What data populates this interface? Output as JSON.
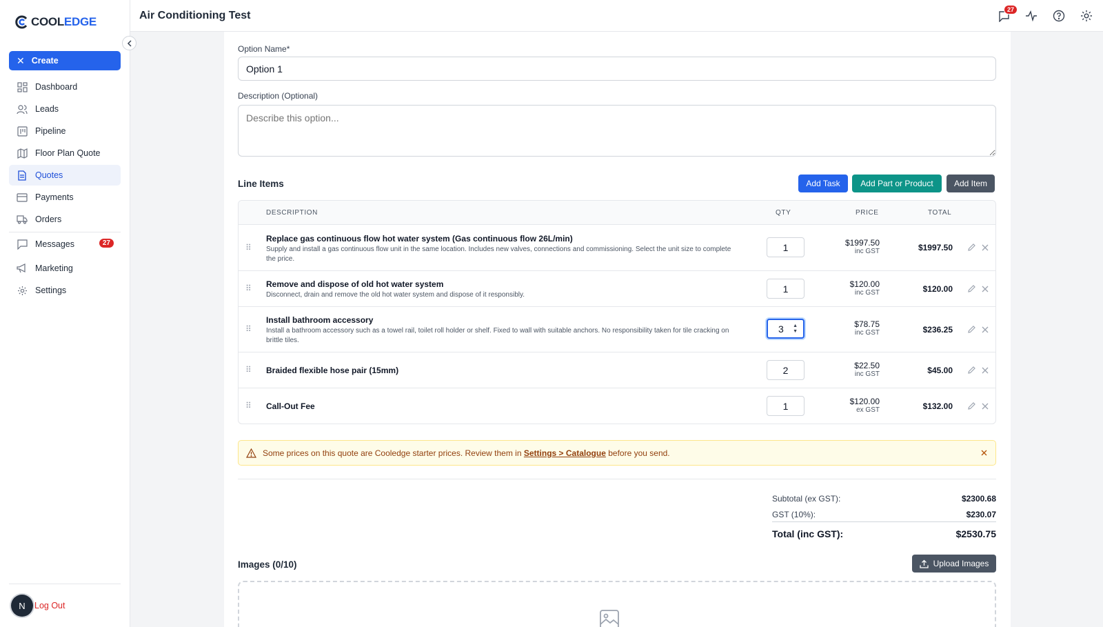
{
  "brand": {
    "name_part1": "COOL",
    "name_part2": "EDGE"
  },
  "sidebar": {
    "create_label": "Create",
    "items": [
      {
        "label": "Dashboard",
        "icon": "dashboard-icon"
      },
      {
        "label": "Leads",
        "icon": "users-icon"
      },
      {
        "label": "Pipeline",
        "icon": "pipeline-icon"
      },
      {
        "label": "Floor Plan Quote",
        "icon": "map-icon"
      },
      {
        "label": "Quotes",
        "icon": "document-icon",
        "active": true
      },
      {
        "label": "Payments",
        "icon": "credit-card-icon"
      },
      {
        "label": "Orders",
        "icon": "truck-icon"
      },
      {
        "label": "Messages",
        "icon": "message-icon",
        "badge": "27"
      },
      {
        "label": "Marketing",
        "icon": "megaphone-icon"
      },
      {
        "label": "Settings",
        "icon": "gear-icon"
      }
    ],
    "avatar_initial": "N",
    "logout_label": "Log Out"
  },
  "header": {
    "title": "Air Conditioning Test",
    "notification_count": "27"
  },
  "form": {
    "option_name_label": "Option Name",
    "option_name_required": "*",
    "option_name_value": "Option 1",
    "description_label": "Description (Optional)",
    "description_placeholder": "Describe this option..."
  },
  "line_items": {
    "title": "Line Items",
    "buttons": {
      "add_task": "Add Task",
      "add_part": "Add Part or Product",
      "add_item": "Add Item"
    },
    "columns": {
      "description": "DESCRIPTION",
      "qty": "QTY",
      "price": "PRICE",
      "total": "TOTAL"
    },
    "rows": [
      {
        "title": "Replace gas continuous flow hot water system (Gas continuous flow 26L/min)",
        "desc": "Supply and install a gas continuous flow unit in the same location. Includes new valves, connections and commissioning. Select the unit size to complete the price.",
        "qty": "1",
        "price": "$1997.50",
        "tax": "inc GST",
        "total": "$1997.50"
      },
      {
        "title": "Remove and dispose of old hot water system",
        "desc": "Disconnect, drain and remove the old hot water system and dispose of it responsibly.",
        "qty": "1",
        "price": "$120.00",
        "tax": "inc GST",
        "total": "$120.00"
      },
      {
        "title": "Install bathroom accessory",
        "desc": "Install a bathroom accessory such as a towel rail, toilet roll holder or shelf. Fixed to wall with suitable anchors. No responsibility taken for tile cracking on brittle tiles.",
        "qty": "3",
        "price": "$78.75",
        "tax": "inc GST",
        "total": "$236.25"
      },
      {
        "title": "Braided flexible hose pair (15mm)",
        "desc": "",
        "qty": "2",
        "price": "$22.50",
        "tax": "inc GST",
        "total": "$45.00"
      },
      {
        "title": "Call-Out Fee",
        "desc": "",
        "qty": "1",
        "price": "$120.00",
        "tax": "ex GST",
        "total": "$132.00"
      }
    ]
  },
  "warning": {
    "text_before": "Some prices on this quote are Cooledge starter prices. Review them in ",
    "link": "Settings > Catalogue",
    "text_after": " before you send."
  },
  "summary": {
    "subtotal_label": "Subtotal (ex GST):",
    "subtotal_value": "$2300.68",
    "gst_label": "GST (10%):",
    "gst_value": "$230.07",
    "total_label": "Total (inc GST):",
    "total_value": "$2530.75"
  },
  "images": {
    "title": "Images (0/10)",
    "upload_label": "Upload Images"
  },
  "colors": {
    "primary": "#2563eb",
    "teal": "#0d9488",
    "dark": "#4b5563",
    "danger": "#dc2626"
  }
}
